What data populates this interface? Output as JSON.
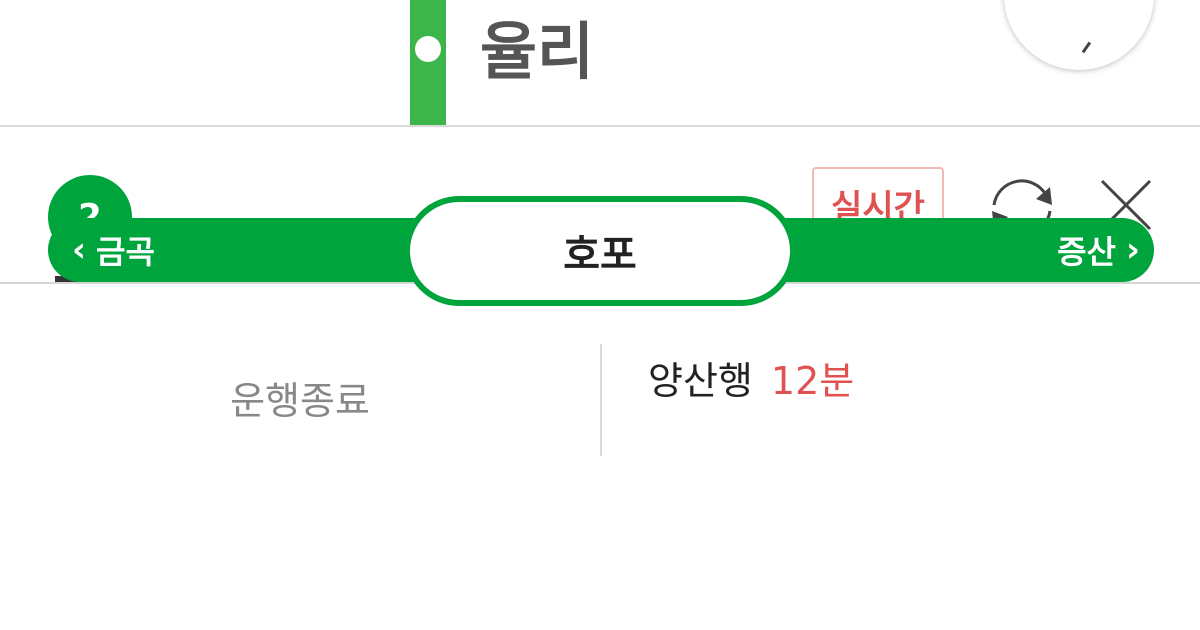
{
  "map": {
    "station_name": "율리",
    "line_color": "#3cb54a"
  },
  "panel": {
    "line_tab": {
      "number": "2",
      "color": "#00a43c"
    },
    "realtime_label": "실시간",
    "realtime_color": "#e05252",
    "icons": {
      "refresh": "refresh-icon",
      "close": "close-icon"
    }
  },
  "route": {
    "prev_station": "금곡",
    "current_station": "호포",
    "next_station": "증산",
    "bar_color": "#00a43c"
  },
  "arrivals": {
    "left_status": "운행종료",
    "right_destination": "양산행",
    "right_eta": "12분",
    "eta_color": "#e05252"
  }
}
